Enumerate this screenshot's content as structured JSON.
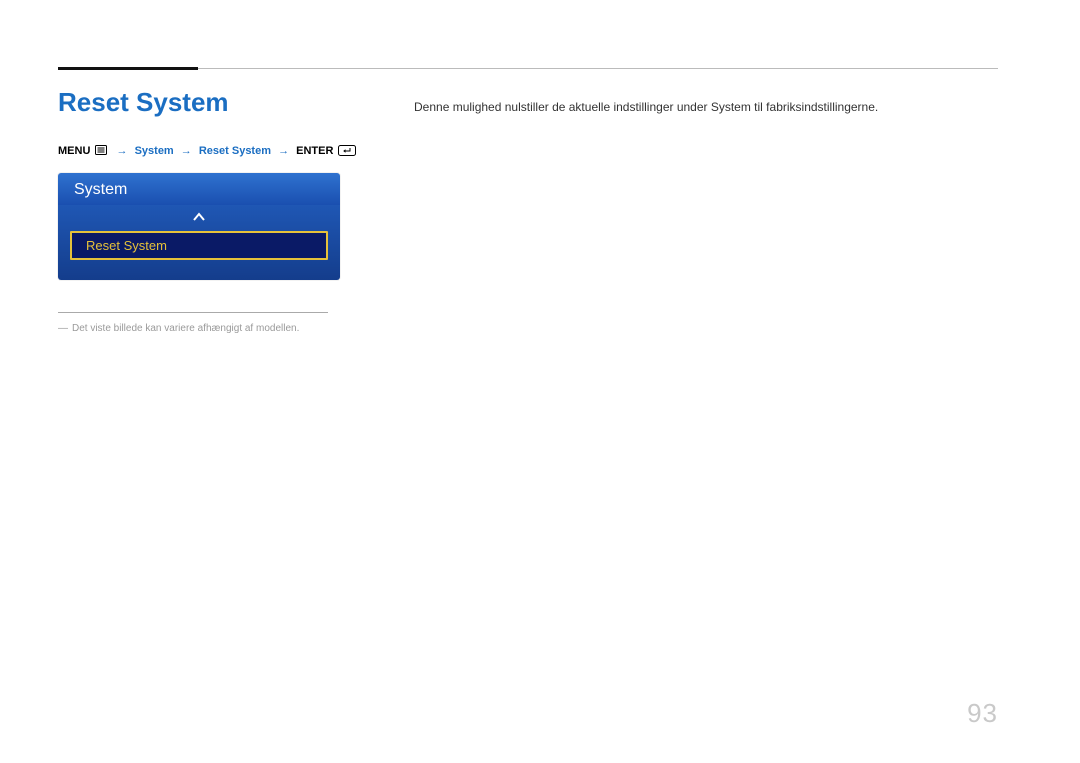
{
  "page_number": "93",
  "title": "Reset System",
  "breadcrumb": {
    "menu_label": "MENU",
    "step1": "System",
    "step2": "Reset System",
    "enter_label": "ENTER"
  },
  "osd": {
    "header": "System",
    "selected_item": "Reset System"
  },
  "footnote": {
    "dash": "―",
    "text": "Det viste billede kan variere afhængigt af modellen."
  },
  "description": "Denne mulighed nulstiller de aktuelle indstillinger under System til fabriksindstillingerne."
}
